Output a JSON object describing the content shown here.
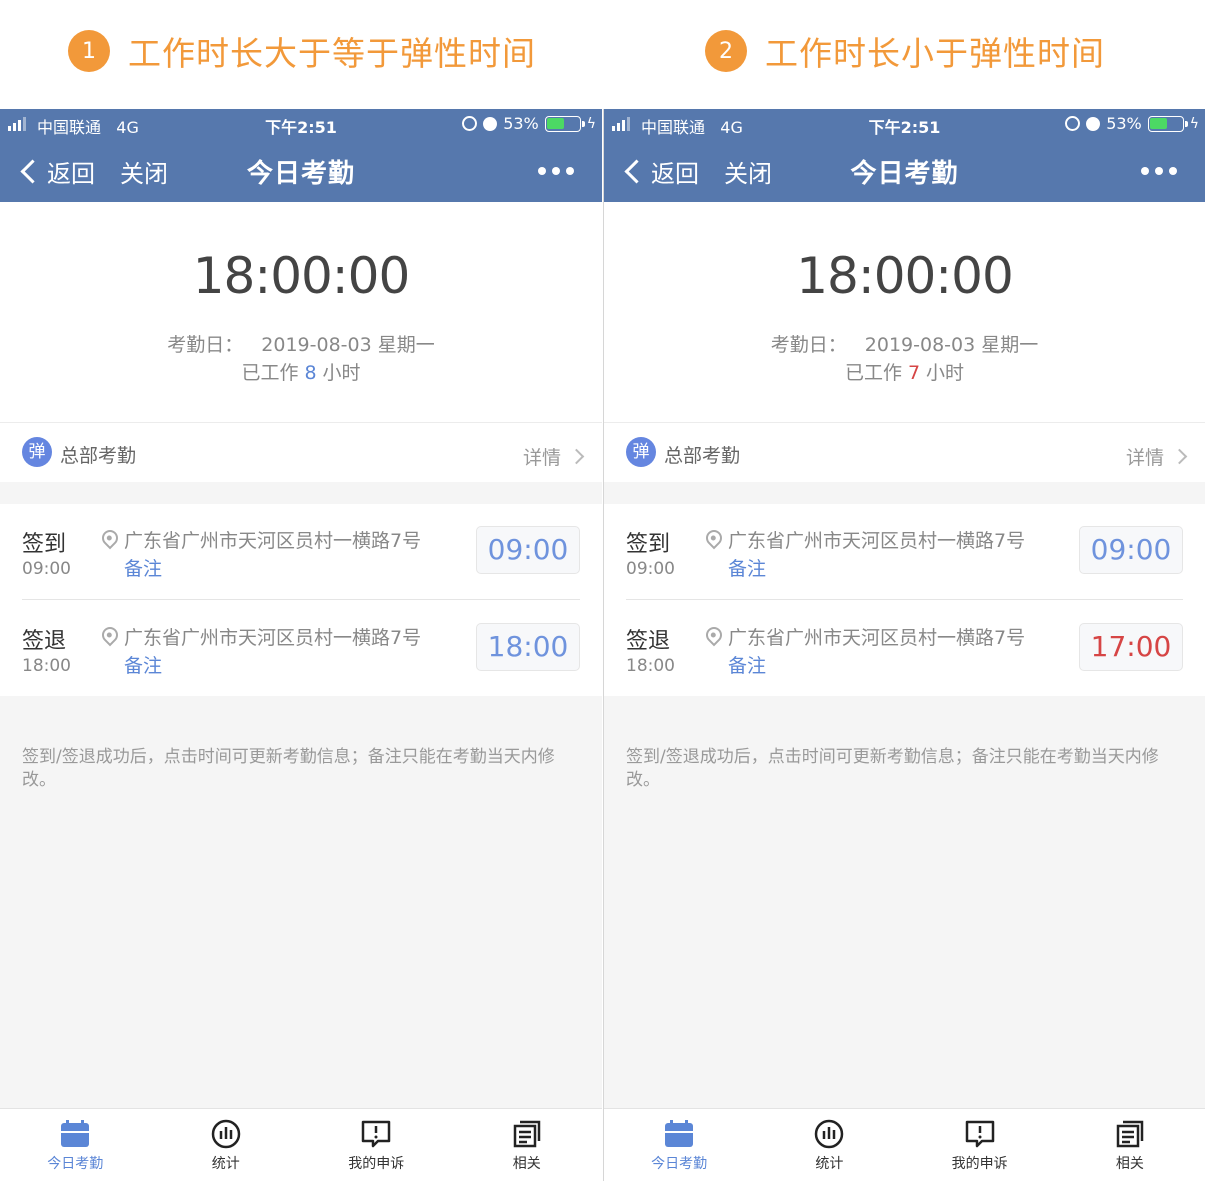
{
  "captions": [
    {
      "num": "1",
      "text": "工作时长大于等于弹性时间"
    },
    {
      "num": "2",
      "text": "工作时长小于弹性时间"
    }
  ],
  "colors": {
    "accent_orange": "#f2993a",
    "navbar_blue": "#5678ad",
    "link_blue": "#5b86d6",
    "warning_red": "#d64545"
  },
  "screens": [
    {
      "status": {
        "carrier": "中国联通",
        "network": "4G",
        "clock": "下午2:51",
        "battery": "53%",
        "battery_level": 0.53
      },
      "nav": {
        "back": "返回",
        "close": "关闭",
        "title": "今日考勤"
      },
      "hero": {
        "time": "18:00:00",
        "date_label": "考勤日：",
        "date_value": "2019-08-03 星期一",
        "worked_prefix": "已工作",
        "worked_hours": "8",
        "worked_suffix": "小时"
      },
      "dept": {
        "badge": "弹",
        "name": "总部考勤",
        "detail": "详情"
      },
      "records": [
        {
          "kind": "签到",
          "time": "09:00",
          "address": "广东省广州市天河区员村一横路7号",
          "note": "备注",
          "punch": "09:00",
          "warn": false
        },
        {
          "kind": "签退",
          "time": "18:00",
          "address": "广东省广州市天河区员村一横路7号",
          "note": "备注",
          "punch": "18:00",
          "warn": false
        }
      ],
      "tip": "签到/签退成功后，点击时间可更新考勤信息；备注只能在考勤当天内修改。",
      "tabs": [
        {
          "label": "今日考勤",
          "icon": "calendar-icon"
        },
        {
          "label": "统计",
          "icon": "stats-icon"
        },
        {
          "label": "我的申诉",
          "icon": "appeal-icon"
        },
        {
          "label": "相关",
          "icon": "related-icon"
        }
      ]
    },
    {
      "status": {
        "carrier": "中国联通",
        "network": "4G",
        "clock": "下午2:51",
        "battery": "53%",
        "battery_level": 0.53
      },
      "nav": {
        "back": "返回",
        "close": "关闭",
        "title": "今日考勤"
      },
      "hero": {
        "time": "18:00:00",
        "date_label": "考勤日：",
        "date_value": "2019-08-03 星期一",
        "worked_prefix": "已工作",
        "worked_hours": "7",
        "worked_suffix": "小时"
      },
      "dept": {
        "badge": "弹",
        "name": "总部考勤",
        "detail": "详情"
      },
      "records": [
        {
          "kind": "签到",
          "time": "09:00",
          "address": "广东省广州市天河区员村一横路7号",
          "note": "备注",
          "punch": "09:00",
          "warn": false
        },
        {
          "kind": "签退",
          "time": "18:00",
          "address": "广东省广州市天河区员村一横路7号",
          "note": "备注",
          "punch": "17:00",
          "warn": true
        }
      ],
      "tip": "签到/签退成功后，点击时间可更新考勤信息；备注只能在考勤当天内修改。",
      "tabs": [
        {
          "label": "今日考勤",
          "icon": "calendar-icon"
        },
        {
          "label": "统计",
          "icon": "stats-icon"
        },
        {
          "label": "我的申诉",
          "icon": "appeal-icon"
        },
        {
          "label": "相关",
          "icon": "related-icon"
        }
      ]
    }
  ]
}
